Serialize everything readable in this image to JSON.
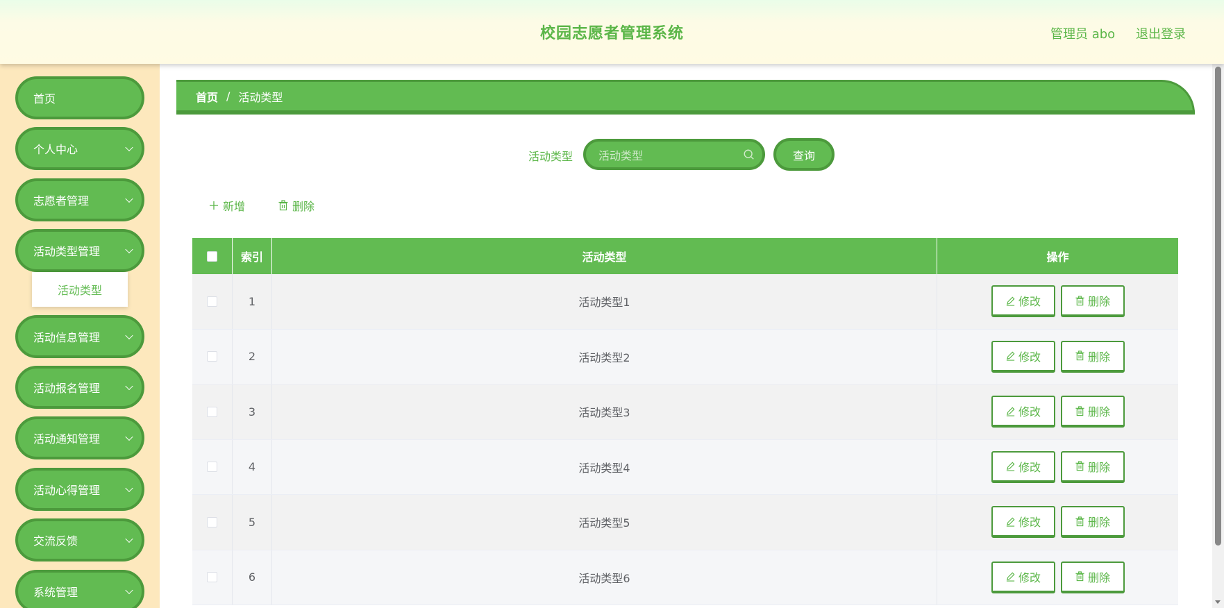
{
  "header": {
    "title": "校园志愿者管理系统",
    "user": "管理员 abo",
    "logout": "退出登录"
  },
  "sidebar": {
    "items": [
      {
        "label": "首页",
        "has_chevron": false
      },
      {
        "label": "个人中心",
        "has_chevron": true
      },
      {
        "label": "志愿者管理",
        "has_chevron": true
      },
      {
        "label": "活动类型管理",
        "has_chevron": true
      },
      {
        "label": "活动信息管理",
        "has_chevron": true
      },
      {
        "label": "活动报名管理",
        "has_chevron": true
      },
      {
        "label": "活动通知管理",
        "has_chevron": true
      },
      {
        "label": "活动心得管理",
        "has_chevron": true
      },
      {
        "label": "交流反馈",
        "has_chevron": true
      },
      {
        "label": "系统管理",
        "has_chevron": true
      }
    ],
    "submenu": {
      "label": "活动类型"
    }
  },
  "breadcrumb": {
    "home": "首页",
    "separator": "/",
    "current": "活动类型"
  },
  "search": {
    "label": "活动类型",
    "placeholder": "活动类型",
    "button": "查询"
  },
  "toolbar": {
    "add": "新增",
    "delete": "删除"
  },
  "table": {
    "headers": {
      "index": "索引",
      "type": "活动类型",
      "ops": "操作"
    },
    "rows": [
      {
        "index": "1",
        "type": "活动类型1"
      },
      {
        "index": "2",
        "type": "活动类型2"
      },
      {
        "index": "3",
        "type": "活动类型3"
      },
      {
        "index": "4",
        "type": "活动类型4"
      },
      {
        "index": "5",
        "type": "活动类型5"
      },
      {
        "index": "6",
        "type": "活动类型6"
      }
    ],
    "edit_label": "修改",
    "delete_label": "删除"
  },
  "colors": {
    "accent": "#62bb52",
    "accent_dark": "#4c9a3c",
    "sidebar_bg": "#fde8bd",
    "text_green": "#5bb648"
  },
  "icons": {
    "search": "search-icon",
    "add": "plus-icon",
    "delete": "trash-icon",
    "edit": "edit-icon",
    "chevron": "chevron-down-icon"
  }
}
